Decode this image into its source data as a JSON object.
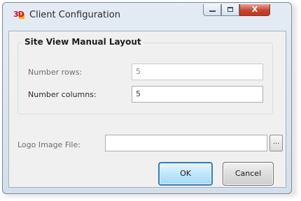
{
  "window": {
    "title": "Client Configuration",
    "close_glyph": "X"
  },
  "site_view": {
    "group_title": "Site View Manual Layout",
    "rows_label": "Number rows:",
    "rows_value": "5",
    "columns_label": "Number columns:",
    "columns_value": "5"
  },
  "logo": {
    "label": "Logo Image File:",
    "value": "",
    "browse_label": "..."
  },
  "buttons": {
    "ok_label": "OK",
    "cancel_label": "Cancel"
  },
  "icons": {
    "app": "app-logo-icon",
    "minimize": "minimize-icon",
    "maximize": "maximize-icon",
    "close": "close-icon"
  },
  "colors": {
    "ok_button_border": "#3c7fb1",
    "close_button": "#c7442f",
    "app_icon_red": "#c8102e",
    "app_icon_yellow": "#f2a900"
  }
}
